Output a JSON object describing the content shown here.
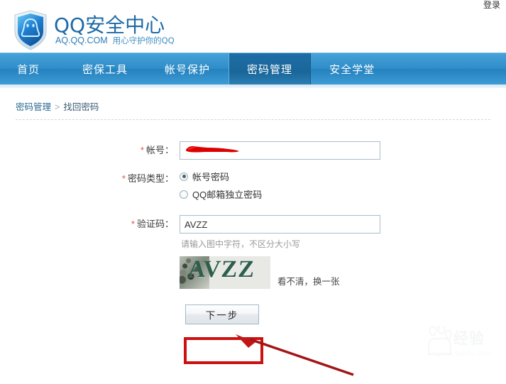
{
  "topbar": {
    "login_label": "登录"
  },
  "header": {
    "brand_title": "QQ安全中心",
    "brand_domain": "AQ.QQ.COM",
    "brand_slogan": "用心守护你的QQ",
    "logo_icon": "qq-shield-icon"
  },
  "nav": {
    "items": [
      {
        "label": "首页",
        "active": false
      },
      {
        "label": "密保工具",
        "active": false
      },
      {
        "label": "帐号保护",
        "active": false
      },
      {
        "label": "密码管理",
        "active": true
      },
      {
        "label": "安全学堂",
        "active": false
      }
    ]
  },
  "breadcrumb": {
    "parent": "密码管理",
    "separator": ">",
    "current": "找回密码"
  },
  "form": {
    "account": {
      "label": "帐号：",
      "required_mark": "*",
      "value": "",
      "placeholder": "",
      "redacted": true
    },
    "password_type": {
      "label": "密码类型：",
      "required_mark": "*",
      "options": [
        {
          "label": "帐号密码",
          "checked": true
        },
        {
          "label": "QQ邮箱独立密码",
          "checked": false
        }
      ]
    },
    "captcha": {
      "label": "验证码：",
      "required_mark": "*",
      "value": "AVZZ",
      "placeholder": "",
      "hint": "请输入图中字符，不区分大小写",
      "image_text": "AVZZ",
      "refresh_label": "看不清，换一张"
    },
    "submit_label": "下一步"
  },
  "annotation": {
    "highlight_color": "#cc1111",
    "target": "下一步"
  },
  "watermark": {
    "brand": "Baidu",
    "text": "经验",
    "url": "jingyan.baidu.com"
  },
  "colors": {
    "nav_blue": "#2f8dc8",
    "nav_active": "#1a6699",
    "brand_blue": "#1c6aa8",
    "annotation_red": "#cc1111"
  }
}
